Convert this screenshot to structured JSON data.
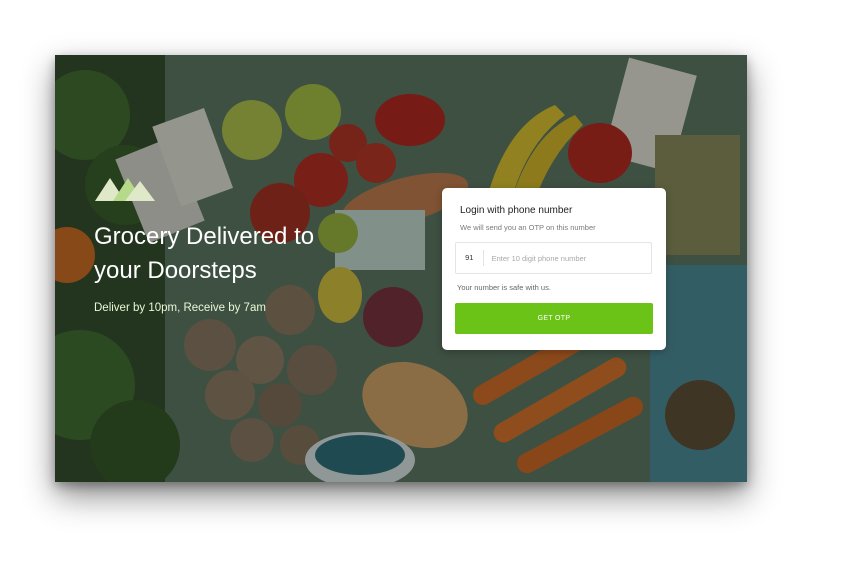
{
  "hero": {
    "headline": "Grocery Delivered to your Doorsteps",
    "tagline": "Deliver by 10pm, Receive by 7am",
    "background_icon": "groceries-photo"
  },
  "brand": {
    "logo_icon": "mountain-logo-icon",
    "accent_color": "#6cc318"
  },
  "login": {
    "title": "Login with phone number",
    "subtitle": "We will send you an OTP on this number",
    "country_code": "91",
    "phone_placeholder": "Enter 10 digit phone number",
    "phone_value": "",
    "safe_note": "Your number is safe with us.",
    "button_label": "GET OTP"
  }
}
